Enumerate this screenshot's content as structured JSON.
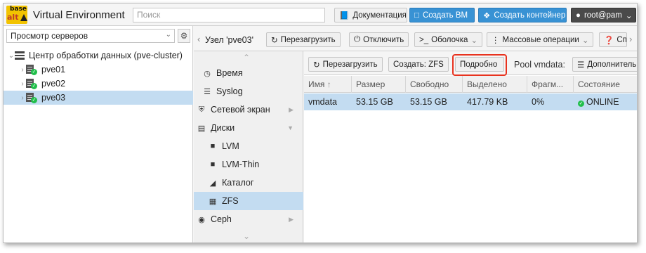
{
  "header": {
    "logo_top": "base",
    "logo_bottom": "alt",
    "app_title": "Virtual Environment",
    "search_placeholder": "Поиск",
    "docs_label": "Документация",
    "create_vm_label": "Создать ВМ",
    "create_ct_label": "Создать контейнер",
    "user_label": "root@pam"
  },
  "tree": {
    "view_select": "Просмотр серверов",
    "datacenter": "Центр обработки данных (pve-cluster)",
    "nodes": [
      "pve01",
      "pve02",
      "pve03"
    ],
    "selected_node": "pve03"
  },
  "node_toolbar": {
    "title": "Узел 'pve03'",
    "restart": "Перезагрузить",
    "shutdown": "Отключить",
    "shell": "Оболочка",
    "bulk": "Массовые операции",
    "help": "Сп"
  },
  "menu": {
    "items": [
      {
        "label": "Время",
        "icon": "clock-icon"
      },
      {
        "label": "Syslog",
        "icon": "list-icon"
      },
      {
        "label": "Сетевой экран",
        "icon": "shield-icon"
      },
      {
        "label": "Диски",
        "icon": "hdd-icon"
      },
      {
        "label": "LVM",
        "icon": "square-icon"
      },
      {
        "label": "LVM-Thin",
        "icon": "square-icon"
      },
      {
        "label": "Каталог",
        "icon": "folder-icon"
      },
      {
        "label": "ZFS",
        "icon": "grid-icon"
      },
      {
        "label": "Ceph",
        "icon": "ceph-icon"
      }
    ],
    "selected": "ZFS"
  },
  "content": {
    "reload": "Перезагрузить",
    "create_zfs": "Создать: ZFS",
    "details": "Подробно",
    "pool_label": "Pool vmdata:",
    "more": "Дополнительно",
    "columns": [
      "Имя",
      "Размер",
      "Свободно",
      "Выделено",
      "Фрагм...",
      "Состояние"
    ],
    "rows": [
      {
        "name": "vmdata",
        "size": "53.15 GB",
        "free": "53.15 GB",
        "alloc": "417.79 KB",
        "frag": "0%",
        "health": "ONLINE"
      }
    ]
  },
  "colors": {
    "accent": "#3892d4",
    "selection": "#c3dcf1",
    "highlight_box": "#e8321e",
    "status_ok": "#21bf4b"
  }
}
